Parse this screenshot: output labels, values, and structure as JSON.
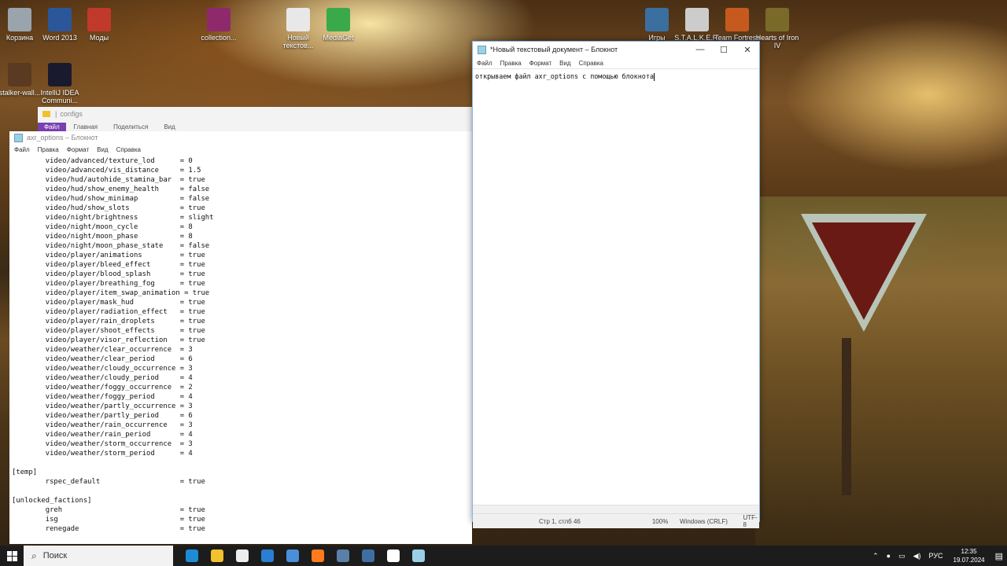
{
  "desktop": {
    "icons": [
      {
        "label": "Корзина",
        "icon": "recycle-bin-icon",
        "color": "#9aa4ad"
      },
      {
        "label": "Word 2013",
        "icon": "word-icon",
        "color": "#2b579a"
      },
      {
        "label": "Моды",
        "icon": "mods-icon",
        "color": "#c0392b"
      },
      {
        "label": "collection...",
        "icon": "archive-icon",
        "color": "#8e2a6b"
      },
      {
        "label": "Новый текстов...",
        "icon": "text-file-icon",
        "color": "#e8e8e8"
      },
      {
        "label": "MediaGet",
        "icon": "mediaget-icon",
        "color": "#3aa94a"
      },
      {
        "label": "Игры",
        "icon": "games-icon",
        "color": "#3b6fa0"
      },
      {
        "label": "S.T.A.L.K.E.R.",
        "icon": "stalker-icon",
        "color": "#cccccc"
      },
      {
        "label": "Team Fortress",
        "icon": "tf2-icon",
        "color": "#c65a1e"
      },
      {
        "label": "Hearts of Iron IV",
        "icon": "hoi4-icon",
        "color": "#7a6a2a"
      },
      {
        "label": "stalker-wall...",
        "icon": "image-file-icon",
        "color": "#5a3a20"
      },
      {
        "label": "IntelliJ IDEA Communi...",
        "icon": "intellij-icon",
        "color": "#1a1a2e"
      }
    ]
  },
  "explorer": {
    "path": "configs",
    "tabs": [
      "Файл",
      "Главная",
      "Поделиться",
      "Вид"
    ]
  },
  "notepad_left": {
    "title": "axr_options – Блокнот",
    "menu": [
      "Файл",
      "Правка",
      "Формат",
      "Вид",
      "Справка"
    ],
    "lines": [
      "        video/advanced/texture_lod      = 0",
      "        video/advanced/vis_distance     = 1.5",
      "        video/hud/autohide_stamina_bar  = true",
      "        video/hud/show_enemy_health     = false",
      "        video/hud/show_minimap          = false",
      "        video/hud/show_slots            = true",
      "        video/night/brightness          = slight",
      "        video/night/moon_cycle          = 8",
      "        video/night/moon_phase          = 8",
      "        video/night/moon_phase_state    = false",
      "        video/player/animations         = true",
      "        video/player/bleed_effect       = true",
      "        video/player/blood_splash       = true",
      "        video/player/breathing_fog      = true",
      "        video/player/item_swap_animation = true",
      "        video/player/mask_hud           = true",
      "        video/player/radiation_effect   = true",
      "        video/player/rain_droplets      = true",
      "        video/player/shoot_effects      = true",
      "        video/player/visor_reflection   = true",
      "        video/weather/clear_occurrence  = 3",
      "        video/weather/clear_period      = 6",
      "        video/weather/cloudy_occurrence = 3",
      "        video/weather/cloudy_period     = 4",
      "        video/weather/foggy_occurrence  = 2",
      "        video/weather/foggy_period      = 4",
      "        video/weather/partly_occurrence = 3",
      "        video/weather/partly_period     = 6",
      "        video/weather/rain_occurrence   = 3",
      "        video/weather/rain_period       = 4",
      "        video/weather/storm_occurrence  = 3",
      "        video/weather/storm_period      = 4",
      "",
      "[temp]",
      "        rspec_default                   = true",
      "",
      "[unlocked_factions]",
      "        greh                            = true",
      "        isg                             = true",
      "        renegade                        = true"
    ]
  },
  "notepad_right": {
    "title": "*Новый текстовый документ – Блокнот",
    "menu": [
      "Файл",
      "Правка",
      "Формат",
      "Вид",
      "Справка"
    ],
    "content": "открываем файл axr_options с помощью блокнота",
    "status": {
      "position": "Стр 1, стлб 46",
      "zoom": "100%",
      "line_endings": "Windows (CRLF)",
      "encoding": "UTF-8"
    },
    "controls": {
      "minimize": "—",
      "maximize": "☐",
      "close": "✕"
    }
  },
  "taskbar": {
    "search_placeholder": "Поиск",
    "apps": [
      {
        "name": "edge",
        "color": "#1e8bd6"
      },
      {
        "name": "explorer",
        "color": "#f2c12e"
      },
      {
        "name": "store",
        "color": "#eeeeee"
      },
      {
        "name": "mail",
        "color": "#2a7fd4"
      },
      {
        "name": "downloads",
        "color": "#4a8fd8"
      },
      {
        "name": "firefox",
        "color": "#ff7a1a"
      },
      {
        "name": "steam",
        "color": "#5a7fa8"
      },
      {
        "name": "steam-2",
        "color": "#3f6fa0"
      },
      {
        "name": "chatgpt",
        "color": "#ffffff"
      },
      {
        "name": "notepad",
        "color": "#9ad0e6"
      }
    ],
    "tray": {
      "language": "РУС",
      "time": "12:35",
      "date": "19.07.2024"
    }
  }
}
